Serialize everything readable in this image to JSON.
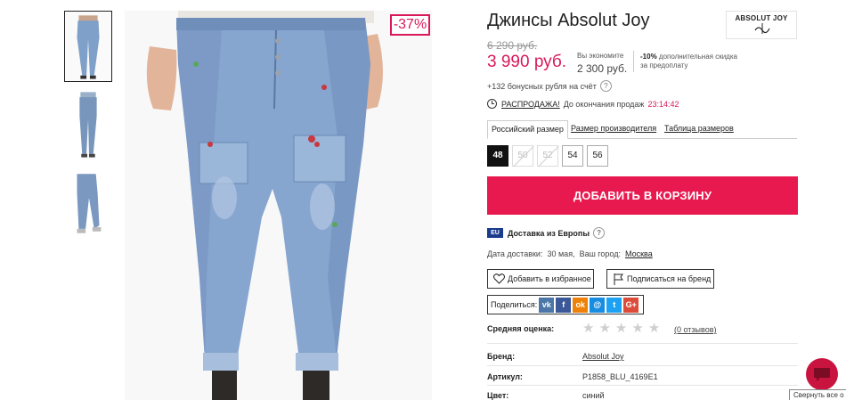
{
  "product": {
    "title": "Джинсы Absolut Joy",
    "brand_logo_text": "ABSOLUT JOY",
    "discount_badge": "-37%",
    "old_price": "6 290 руб.",
    "new_price": "3 990 руб.",
    "save_label": "Вы экономите",
    "save_amount": "2 300 руб.",
    "prepay_bold": "-10%",
    "prepay_text": " дополнительная скидка за предоплату",
    "bonus_text": "+132 бонусных рубля на счёт",
    "help_mark": "?",
    "sale_link": "РАСПРОДАЖА!",
    "sale_text": "До окончания продаж",
    "sale_timer": "23:14:42"
  },
  "size_tabs": [
    "Российский размер",
    "Размер производителя",
    "Таблица размеров"
  ],
  "sizes": [
    {
      "label": "48",
      "state": "selected"
    },
    {
      "label": "50",
      "state": "disabled"
    },
    {
      "label": "52",
      "state": "disabled"
    },
    {
      "label": "54",
      "state": "available"
    },
    {
      "label": "56",
      "state": "available"
    }
  ],
  "add_to_cart": "ДОБАВИТЬ В КОРЗИНУ",
  "delivery": {
    "flag": "EU",
    "text": "Доставка из Европы",
    "date_label": "Дата доставки:",
    "date": "30 мая",
    "city_label": "Ваш город:",
    "city": "Москва"
  },
  "actions": {
    "wishlist": "Добавить в избранное",
    "subscribe": "Подписаться на бренд",
    "share_label": "Поделиться:"
  },
  "social": [
    {
      "name": "vk",
      "glyph": "vk",
      "color": "#4a76a8"
    },
    {
      "name": "facebook",
      "glyph": "f",
      "color": "#3b5998"
    },
    {
      "name": "odnoklassniki",
      "glyph": "ok",
      "color": "#ee8208"
    },
    {
      "name": "moimir",
      "glyph": "@",
      "color": "#168de2"
    },
    {
      "name": "twitter",
      "glyph": "t",
      "color": "#1da1f2"
    },
    {
      "name": "googleplus",
      "glyph": "G+",
      "color": "#dd4b39"
    }
  ],
  "rating": {
    "label": "Средняя оценка:",
    "stars_filled": 0,
    "stars_total": 5,
    "reviews": "(0 отзывов)"
  },
  "specs": [
    {
      "key": "Бренд:",
      "value": "Absolut Joy",
      "link": true
    },
    {
      "key": "Артикул:",
      "value": "P1858_BLU_4169E1",
      "link": false
    },
    {
      "key": "Цвет:",
      "value": "синий",
      "link": false
    }
  ],
  "collapse_tip": "Свернуть все о",
  "colors": {
    "accent": "#e8194f",
    "price": "#d9195a",
    "denim": "#7b9cc6"
  }
}
